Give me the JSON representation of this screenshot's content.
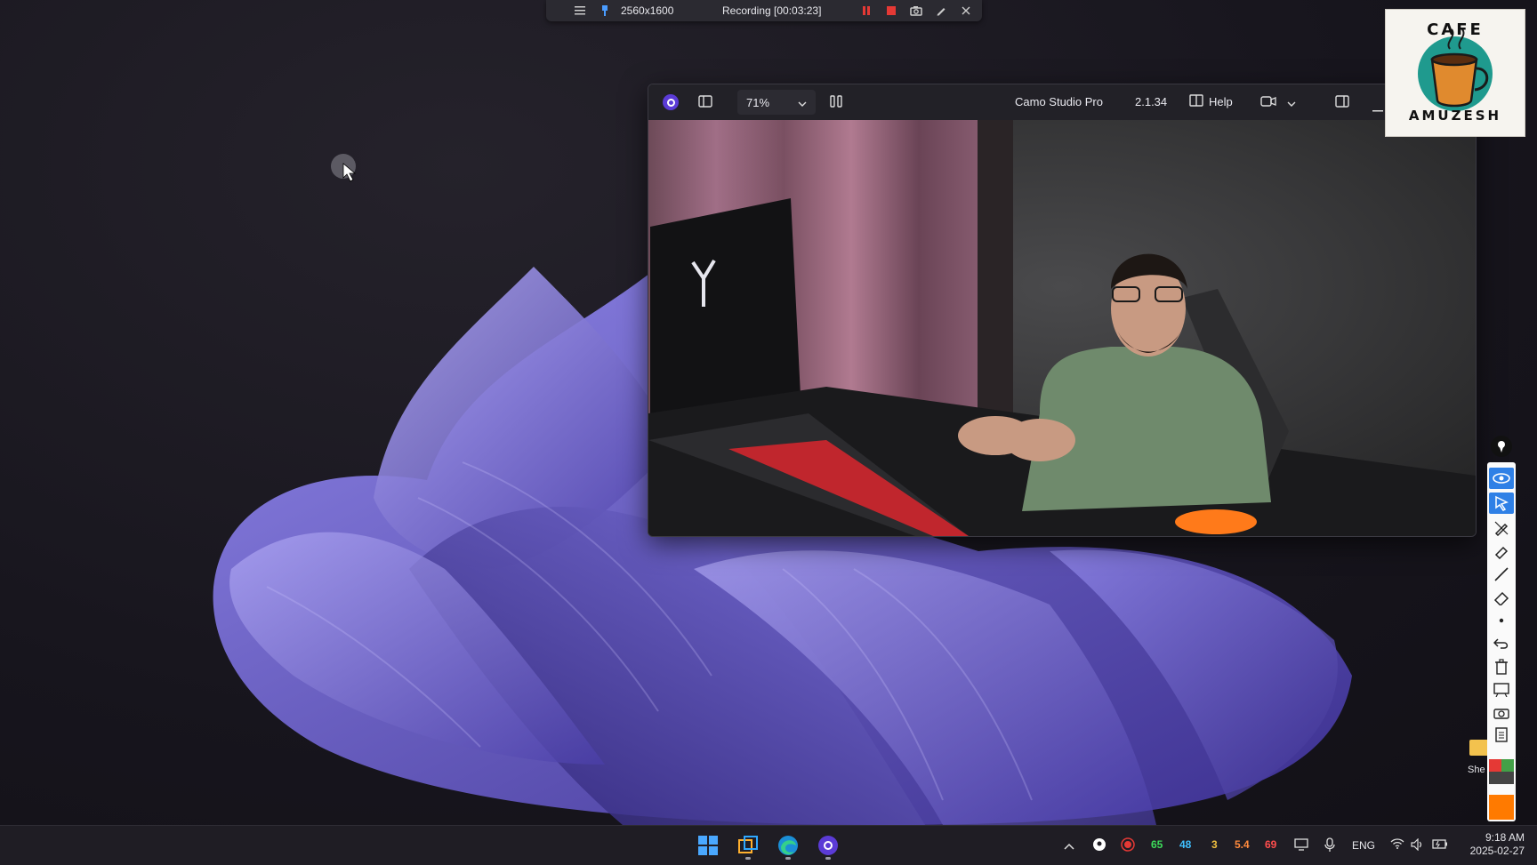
{
  "recording_bar": {
    "resolution": "2560x1600",
    "status": "Recording [00:03:23]",
    "icons": [
      "menu-icon",
      "pin-icon",
      "pause-icon",
      "stop-icon",
      "camera-icon",
      "pen-icon",
      "close-icon"
    ]
  },
  "camo_window": {
    "zoom": "71%",
    "app_name": "Camo Studio Pro",
    "version": "2.1.34",
    "help_label": "Help",
    "icons": [
      "camo-logo-icon",
      "sidebar-icon",
      "chevron-down-icon",
      "columns-icon",
      "book-icon",
      "video-camera-icon",
      "split-view-icon",
      "minimize-icon"
    ]
  },
  "logo": {
    "top_text": "CAFE",
    "bottom_text": "AMUZESH"
  },
  "desktop": {
    "shortcut_label": "She"
  },
  "annotation_toolbar": {
    "tools": [
      "pin-icon",
      "eye-icon",
      "pointer-icon",
      "pen-icon",
      "highlighter-icon",
      "line-icon",
      "eraser-icon",
      "dot-icon",
      "undo-icon",
      "trash-icon",
      "whiteboard-icon",
      "screenshot-icon",
      "clipboard-icon"
    ],
    "colors": [
      "#e53935",
      "#43a047",
      "#444444",
      "#ff7a00"
    ]
  },
  "taskbar": {
    "apps": [
      "windows-start-icon",
      "task-view-icon",
      "edge-icon",
      "camo-icon"
    ],
    "tray": {
      "values": [
        {
          "text": "65",
          "color": "#3ddc5a"
        },
        {
          "text": "48",
          "color": "#3fc0ff"
        },
        {
          "text": "3",
          "color": "#f0c040"
        },
        {
          "text": "5.4",
          "color": "#ff8a3d"
        },
        {
          "text": "69",
          "color": "#ff4d4d"
        }
      ],
      "language": "ENG",
      "time": "9:18 AM",
      "date": "2025-02-27"
    }
  }
}
